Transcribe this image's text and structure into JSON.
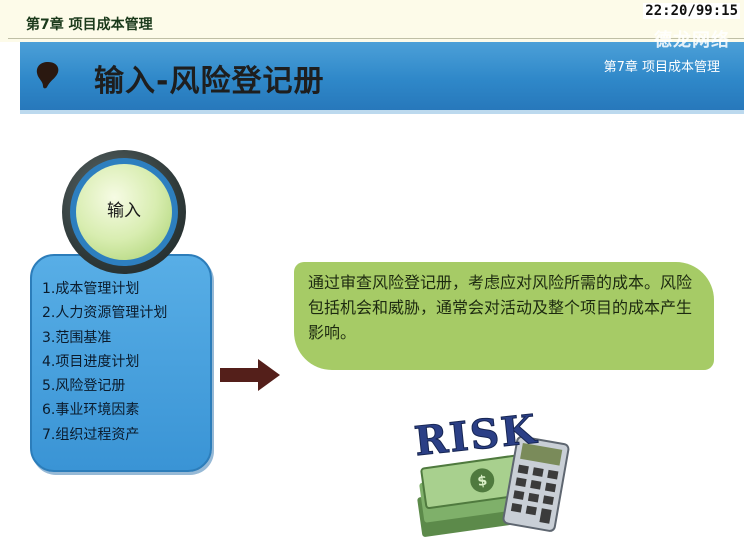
{
  "header": {
    "chapter_label": "第7章 项目成本管理",
    "timer": "22:20/99:15",
    "watermark": "德龙网络"
  },
  "banner": {
    "title": "输入-风险登记册",
    "chapter_label": "第7章 项目成本管理"
  },
  "circle": {
    "label": "输入"
  },
  "inputs": [
    "1.成本管理计划",
    "2.人力资源管理计划",
    "3.范围基准",
    "4.项目进度计划",
    "5.风险登记册",
    "6.事业环境因素",
    "7.组织过程资产"
  ],
  "description": "通过审查风险登记册，考虑应对风险所需的成本。风险包括机会和威胁，通常会对活动及整个项目的成本产生影响。",
  "illustration": {
    "text": "RISK"
  },
  "colors": {
    "banner_blue": "#2f88c9",
    "panel_blue": "#3a94d5",
    "desc_green": "#a6cb66",
    "arrow_brown": "#541f1a"
  }
}
